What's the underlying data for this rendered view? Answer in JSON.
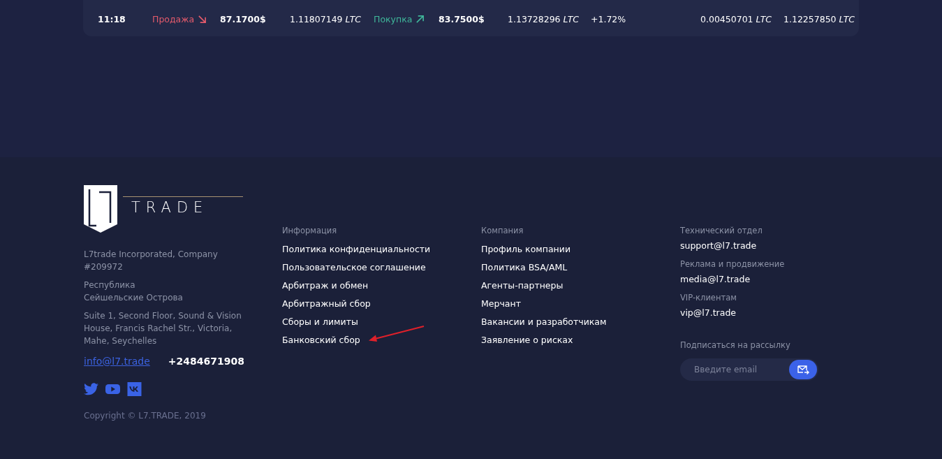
{
  "trades_table": {
    "rows": [
      {
        "time": "11:18",
        "trades": [
          {
            "kind": "sell",
            "label": "Продажа",
            "price": "87.1700$",
            "amount": "1.11807149 *LTC*"
          },
          {
            "kind": "buy",
            "label": "Покупка",
            "price": "83.7500$",
            "amount": "1.13728296 *LTC*"
          }
        ],
        "change": "+1.72%",
        "column_9": "0.00450701 *LTC*",
        "column_10": "1.12257850 *LTC*"
      }
    ]
  },
  "footer": {
    "logo_text": "TRADE",
    "company": "L7trade Incorporated, Company #209972",
    "country_lines": [
      "Республика",
      "Сейшельские Острова"
    ],
    "address": "Suite 1, Second Floor, Sound & Vision House, Francis Rachel Str., Victoria, Mahe, Seychelles",
    "email": "info@l7.trade",
    "phone": "+2484671908",
    "social": [
      {
        "kind": "twitter"
      },
      {
        "kind": "youtube"
      },
      {
        "kind": "vk"
      }
    ],
    "copyright": "Copyright © L7.TRADE, 2019",
    "columns": [
      {
        "title": "Информация",
        "links": [
          "Политика конфиденциальности",
          "Пользовательское соглашение",
          "Арбитраж и обмен",
          "Арбитражный сбор",
          "Сборы и лимиты",
          "Банковский сбор"
        ]
      },
      {
        "title": "Компания",
        "links": [
          "Профиль компании",
          "Политика BSA/AML",
          "Агенты-партнеры",
          "Мерчант",
          "Вакансии и разработчикам",
          "Заявление о рисках"
        ]
      }
    ],
    "contacts": [
      {
        "label": "Технический отдел",
        "email": "support@l7.trade"
      },
      {
        "label": "Реклама и продвижение",
        "email": "media@l7.trade"
      },
      {
        "label": "VIP-клиентам",
        "email": "vip@l7.trade"
      }
    ],
    "subscribe": {
      "label": "Подписаться на рассылку",
      "placeholder": "Введите email"
    }
  }
}
